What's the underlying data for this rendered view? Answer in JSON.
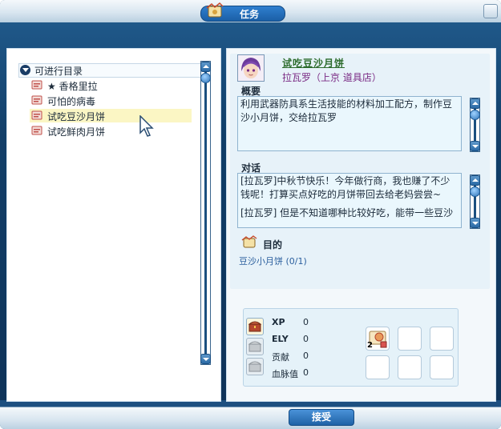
{
  "window": {
    "title": "任务"
  },
  "tree": {
    "root_label": "可进行目录",
    "items": [
      {
        "label": "★ 香格里拉",
        "selected": false
      },
      {
        "label": "可怕的病毒",
        "selected": false
      },
      {
        "label": "试吃豆沙月饼",
        "selected": true
      },
      {
        "label": "试吃鲜肉月饼",
        "selected": false
      }
    ]
  },
  "quest": {
    "name": "试吃豆沙月饼",
    "npc": "拉瓦罗（上京 道具店）",
    "summary_title": "概要",
    "summary_text": "利用武器防具系生活技能的材料加工配方，制作豆沙小月饼，交给拉瓦罗",
    "dialog_title": "对话",
    "dialog_line1": "[拉瓦罗]中秋节快乐！今年做行商，我也赚了不少钱呢！打算买点好吃的月饼带回去给老妈尝尝~",
    "dialog_line2": "[拉瓦罗] 但是不知道哪种比较好吃，能带一些豆沙",
    "goal_title": "目的",
    "goal_item": "豆沙小月饼 (0/1)"
  },
  "rewards": {
    "rows": [
      {
        "label": "XP",
        "value": "0"
      },
      {
        "label": "ELY",
        "value": "0"
      },
      {
        "label": "贡献",
        "value": "0"
      },
      {
        "label": "血脉值",
        "value": "0"
      }
    ],
    "item_count": "2"
  },
  "buttons": {
    "accept": "接受"
  },
  "colors": {
    "accent": "#1d4f80",
    "quest_name": "#2c6b2c",
    "npc": "#7a2a84",
    "goal": "#2b5f9e"
  }
}
